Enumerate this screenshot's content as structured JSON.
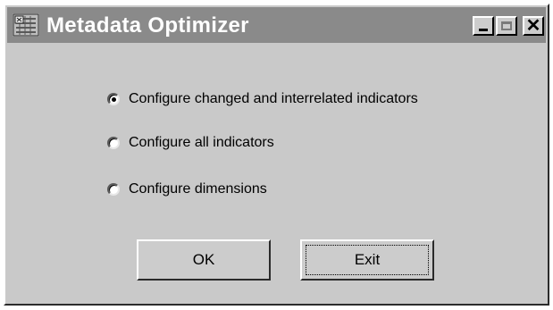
{
  "window": {
    "title": "Metadata Optimizer",
    "app_icon": "application-icon"
  },
  "titlebar_buttons": [
    {
      "name": "minimize-icon"
    },
    {
      "name": "maximize-icon"
    },
    {
      "name": "close-icon"
    }
  ],
  "options": {
    "changed": {
      "label": "Configure changed and interrelated indicators",
      "selected": true
    },
    "all": {
      "label": "Configure all indicators",
      "selected": false
    },
    "dimensions": {
      "label": "Configure dimensions",
      "selected": false
    }
  },
  "buttons": {
    "ok": "OK",
    "exit": "Exit"
  },
  "colors": {
    "titlebar": "#8a8a8a",
    "window_bg": "#c9c9c9"
  }
}
